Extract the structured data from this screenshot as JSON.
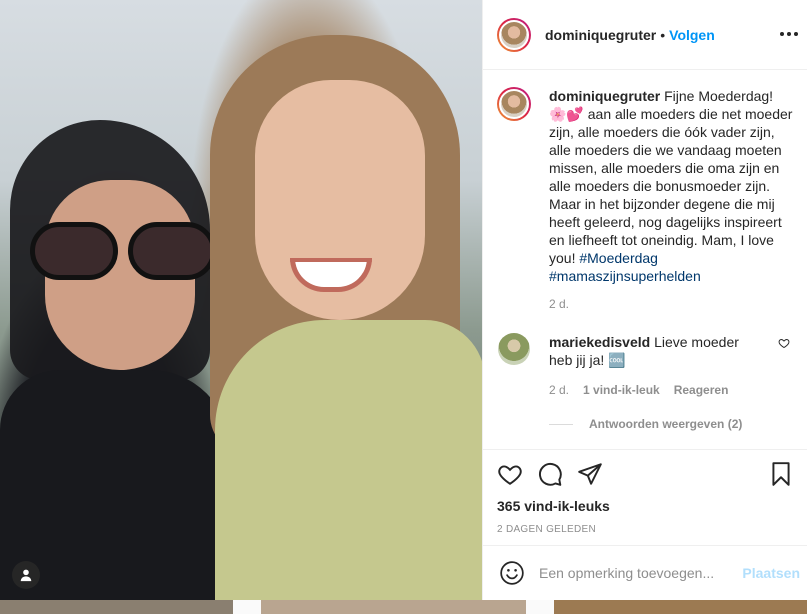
{
  "post": {
    "username": "dominiquegruter",
    "follow_label": "Volgen",
    "dot": "•",
    "caption": {
      "username": "dominiquegruter",
      "text": "Fijne Moederdag! 🌸💕 aan alle moeders die net moeder zijn, alle moeders die óók vader zijn, alle moeders die we vandaag moeten missen, alle moeders die oma zijn en alle moeders die bonusmoeder zijn. Maar in het bijzonder degene die mij heeft geleerd, nog dagelijks inspireert en liefheeft tot oneindig. Mam, I love you!",
      "hashtag1": "#Moederdag",
      "hashtag2": "#mamaszijnsuperhelden",
      "age": "2 d."
    },
    "comment": {
      "username": "mariekedisveld",
      "text": "Lieve moeder heb jij ja! 🆒",
      "age": "2 d.",
      "likes": "1 vind-ik-leuk",
      "reply_label": "Reageren",
      "view_replies": "Antwoorden weergeven (2)"
    },
    "likes_count": "365 vind-ik-leuks",
    "posted": "2 DAGEN GELEDEN",
    "add_comment": {
      "placeholder": "Een opmerking toevoegen...",
      "post_label": "Plaatsen"
    }
  },
  "icons": {
    "like": "heart-icon",
    "comment": "comment-icon",
    "share": "send-icon",
    "save": "bookmark-icon",
    "emoji": "emoji-icon",
    "more": "more-icon",
    "user_tag": "user-tag-icon"
  },
  "colors": {
    "link_blue": "#0095f6",
    "hashtag": "#00376b",
    "muted": "#8e8e8e",
    "post_disabled": "#b2dffc"
  }
}
